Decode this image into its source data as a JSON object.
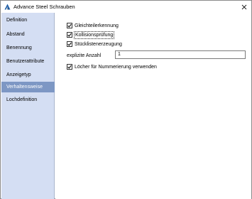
{
  "window": {
    "title": "Advance Steel   Schrauben"
  },
  "sidebar": {
    "items": [
      {
        "label": "Definition"
      },
      {
        "label": "Abstand"
      },
      {
        "label": "Benennung"
      },
      {
        "label": "Benutzerattribute"
      },
      {
        "label": "Anzeigetyp"
      },
      {
        "label": "Verhaltensweise",
        "selected": true
      },
      {
        "label": "Lochdefinition"
      }
    ]
  },
  "content": {
    "checkboxes": [
      {
        "label": "Gleichteilerkennung",
        "checked": true
      },
      {
        "label": "Kollisionsprüfung",
        "checked": true
      },
      {
        "label": "Stücklistenerzeugung",
        "checked": true
      }
    ],
    "explicit_count": {
      "label": "explizite Anzahl",
      "value": "1"
    },
    "hole_numbering": {
      "label": "Löcher für Nummerierung verwenden",
      "checked": true
    }
  },
  "colors": {
    "sidebar_bg": "#d4def3",
    "selected_bg": "#7d97c4",
    "app_icon": "#1f5fa8"
  },
  "icons": {
    "app": "autodesk-a-icon",
    "close": "close-icon",
    "check": "checkmark-icon"
  }
}
